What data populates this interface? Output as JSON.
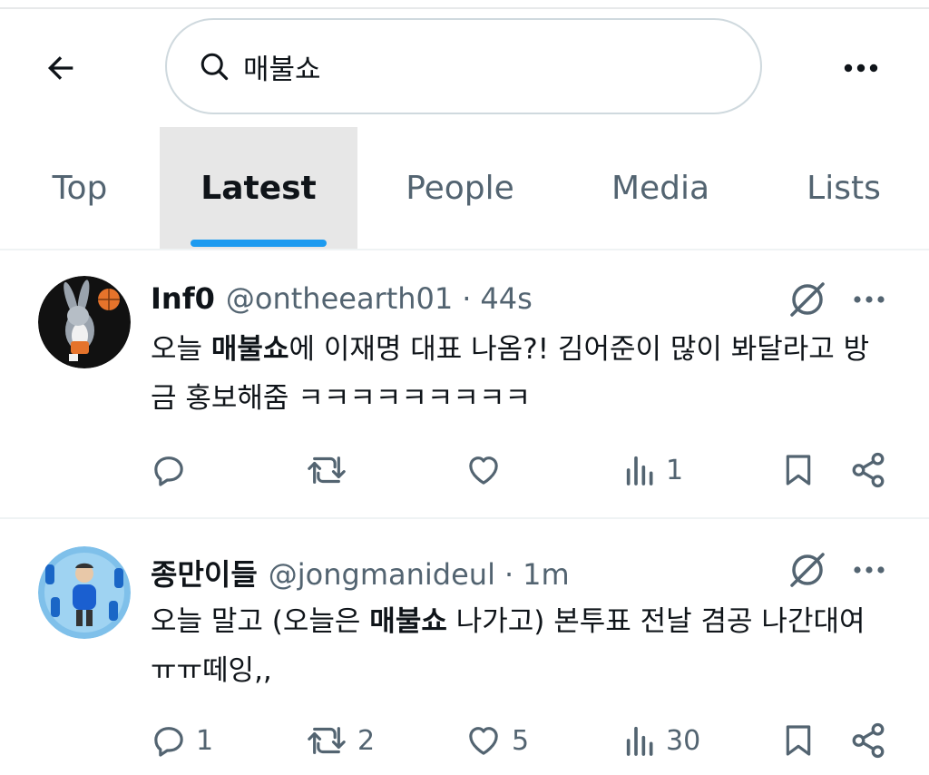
{
  "header": {
    "search_query": "매불쇼"
  },
  "tabs": [
    {
      "label": "Top"
    },
    {
      "label": "Latest"
    },
    {
      "label": "People"
    },
    {
      "label": "Media"
    },
    {
      "label": "Lists"
    }
  ],
  "active_tab": "Latest",
  "accent_color": "#1d9bf0",
  "tweets": [
    {
      "name": "Inf0",
      "handle": "@ontheearth01",
      "separator": "·",
      "time": "44s",
      "text_before": "오늘 ",
      "text_highlight": "매불쇼",
      "text_after": "에 이재명 대표 나옴?! 김어준이 많이 봐달라고 방금 홍보해줌 ㅋㅋㅋㅋㅋㅋㅋㅋㅋ",
      "replies": "",
      "retweets": "",
      "likes": "",
      "views": "1"
    },
    {
      "name": "종만이들",
      "handle": "@jongmanideul",
      "separator": "·",
      "time": "1m",
      "text_before": "오늘 말고 (오늘은 ",
      "text_highlight": "매불쇼",
      "text_after": " 나가고) 본투표 전날 겸공 나간대여ㅠㅠ떼잉,,",
      "replies": "1",
      "retweets": "2",
      "likes": "5",
      "views": "30"
    }
  ],
  "icons": {
    "back": "arrow-left-icon",
    "search": "search-icon",
    "more": "more-horizontal-icon",
    "grok": "grok-icon",
    "reply": "reply-icon",
    "retweet": "retweet-icon",
    "like": "heart-icon",
    "views": "views-icon",
    "bookmark": "bookmark-icon",
    "share": "share-icon"
  }
}
